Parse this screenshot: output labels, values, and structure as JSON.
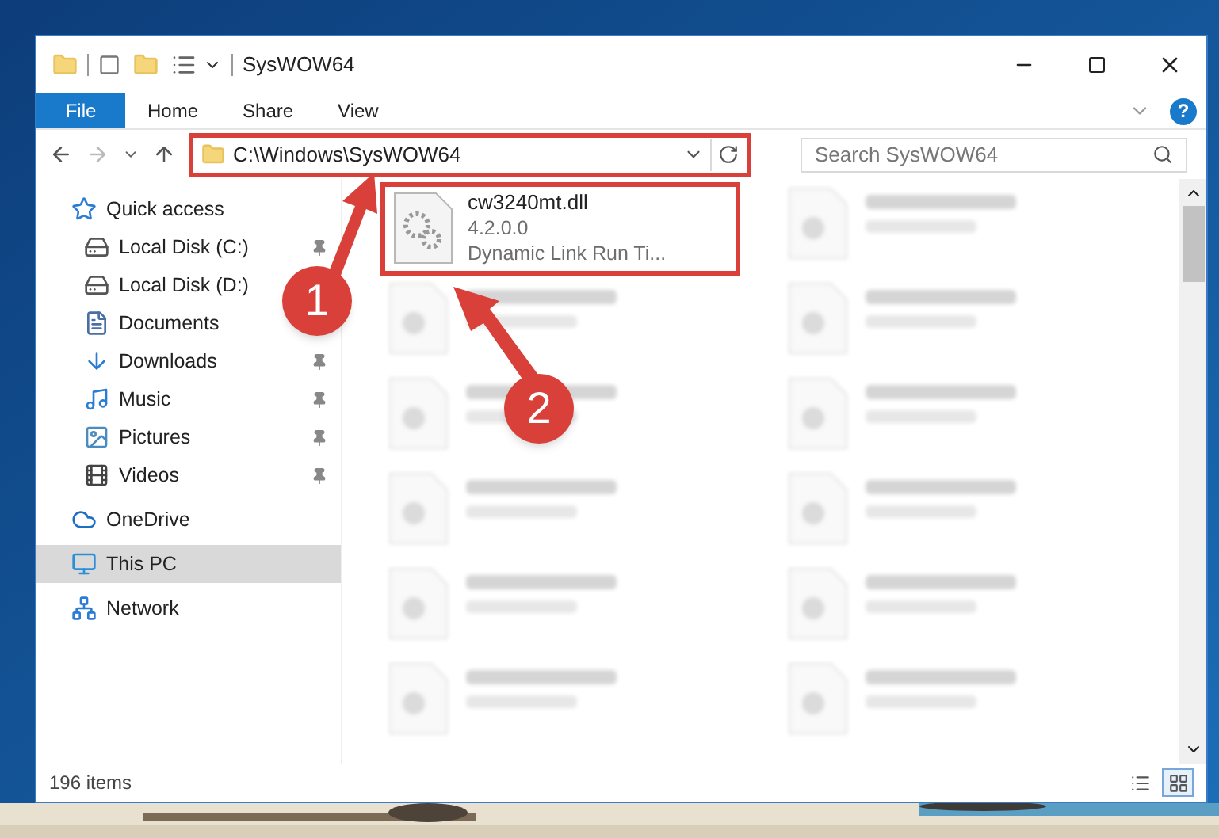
{
  "window": {
    "title": "SysWOW64",
    "help": "?"
  },
  "ribbon_tabs": [
    {
      "label": "File",
      "kind": "file"
    },
    {
      "label": "Home",
      "kind": "tab"
    },
    {
      "label": "Share",
      "kind": "tab"
    },
    {
      "label": "View",
      "kind": "tab"
    }
  ],
  "address_bar": {
    "path": "C:\\Windows\\SysWOW64",
    "highlighted": true
  },
  "search": {
    "placeholder": "Search SysWOW64"
  },
  "sidebar": {
    "items": [
      {
        "label": "Quick access",
        "kind": "star",
        "pinned": false,
        "selected": false,
        "group": true
      },
      {
        "label": "Local Disk (C:)",
        "kind": "drive-c",
        "pinned": true,
        "selected": false,
        "group": false
      },
      {
        "label": "Local Disk (D:)",
        "kind": "drive",
        "pinned": false,
        "selected": false,
        "group": false
      },
      {
        "label": "Documents",
        "kind": "documents",
        "pinned": false,
        "selected": false,
        "group": false
      },
      {
        "label": "Downloads",
        "kind": "downloads",
        "pinned": true,
        "selected": false,
        "group": false
      },
      {
        "label": "Music",
        "kind": "music",
        "pinned": true,
        "selected": false,
        "group": false
      },
      {
        "label": "Pictures",
        "kind": "pictures",
        "pinned": true,
        "selected": false,
        "group": false
      },
      {
        "label": "Videos",
        "kind": "videos",
        "pinned": true,
        "selected": false,
        "group": false
      },
      {
        "label": "OneDrive",
        "kind": "cloud",
        "pinned": false,
        "selected": false,
        "group": true
      },
      {
        "label": "This PC",
        "kind": "pc",
        "pinned": false,
        "selected": true,
        "group": true
      },
      {
        "label": "Network",
        "kind": "network",
        "pinned": false,
        "selected": false,
        "group": true
      }
    ]
  },
  "files": [
    {
      "kind": "file",
      "name": "cw3240mt.dll",
      "details": [
        "4.2.0.0",
        "Dynamic Link Run Ti..."
      ],
      "highlighted": true
    },
    {
      "kind": "blurred"
    },
    {
      "kind": "blurred"
    },
    {
      "kind": "blurred"
    },
    {
      "kind": "blurred"
    },
    {
      "kind": "blurred"
    },
    {
      "kind": "blurred"
    },
    {
      "kind": "blurred"
    },
    {
      "kind": "blurred"
    },
    {
      "kind": "blurred"
    },
    {
      "kind": "blurred"
    },
    {
      "kind": "blurred"
    }
  ],
  "status_bar": {
    "items": "196 items",
    "views": [
      {
        "kind": "details",
        "selected": false
      },
      {
        "kind": "large-icons",
        "selected": true
      }
    ]
  },
  "annotations": [
    {
      "label": "1"
    },
    {
      "label": "2"
    }
  ]
}
